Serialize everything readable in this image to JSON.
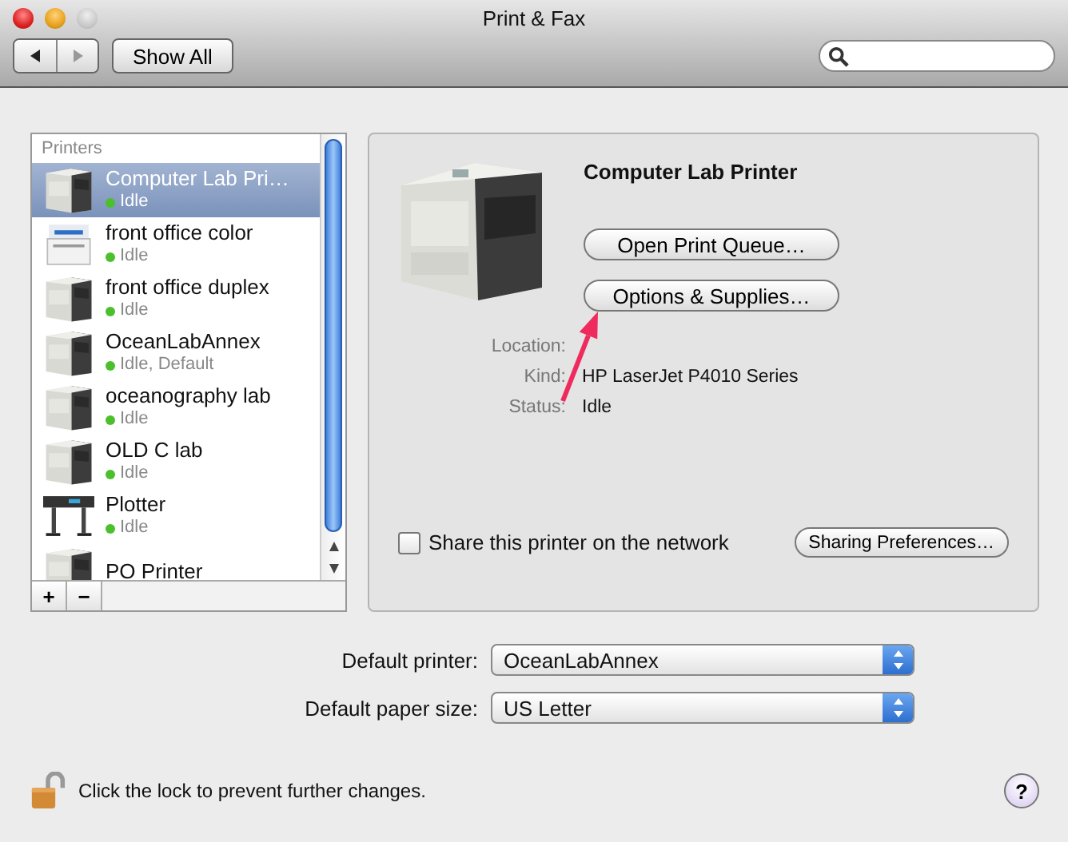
{
  "window": {
    "title": "Print & Fax"
  },
  "toolbar": {
    "show_all": "Show All",
    "back_enabled": true,
    "forward_enabled": false
  },
  "printers": {
    "header": "Printers",
    "items": [
      {
        "name": "Computer Lab Pri…",
        "status": "Idle",
        "kind": "laser",
        "selected": true
      },
      {
        "name": "front office color",
        "status": "Idle",
        "kind": "color",
        "selected": false
      },
      {
        "name": "front office duplex",
        "status": "Idle",
        "kind": "laser",
        "selected": false
      },
      {
        "name": "OceanLabAnnex",
        "status": "Idle, Default",
        "kind": "laser",
        "selected": false
      },
      {
        "name": "oceanography lab",
        "status": "Idle",
        "kind": "laser",
        "selected": false
      },
      {
        "name": "OLD C lab",
        "status": "Idle",
        "kind": "laser",
        "selected": false
      },
      {
        "name": "Plotter",
        "status": "Idle",
        "kind": "plotter",
        "selected": false
      },
      {
        "name": "PO Printer",
        "kind": "laser",
        "selected": false
      }
    ],
    "add": "+",
    "remove": "−"
  },
  "detail": {
    "name": "Computer Lab Printer",
    "buttons": [
      "Open Print Queue…",
      "Options & Supplies…"
    ],
    "fields": [
      {
        "label": "Location:"
      },
      {
        "label": "Kind:",
        "value": "HP LaserJet P4010 Series"
      },
      {
        "label": "Status:",
        "value": "Idle"
      }
    ],
    "share": {
      "label": "Share this printer on the network",
      "checked": false
    },
    "sharing_button": "Sharing Preferences…"
  },
  "defaults": [
    {
      "label": "Default printer:",
      "value": "OceanLabAnnex"
    },
    {
      "label": "Default paper size:",
      "value": "US Letter"
    }
  ],
  "lock": {
    "text": "Click the lock to prevent further changes.",
    "locked": false
  },
  "help": "?"
}
